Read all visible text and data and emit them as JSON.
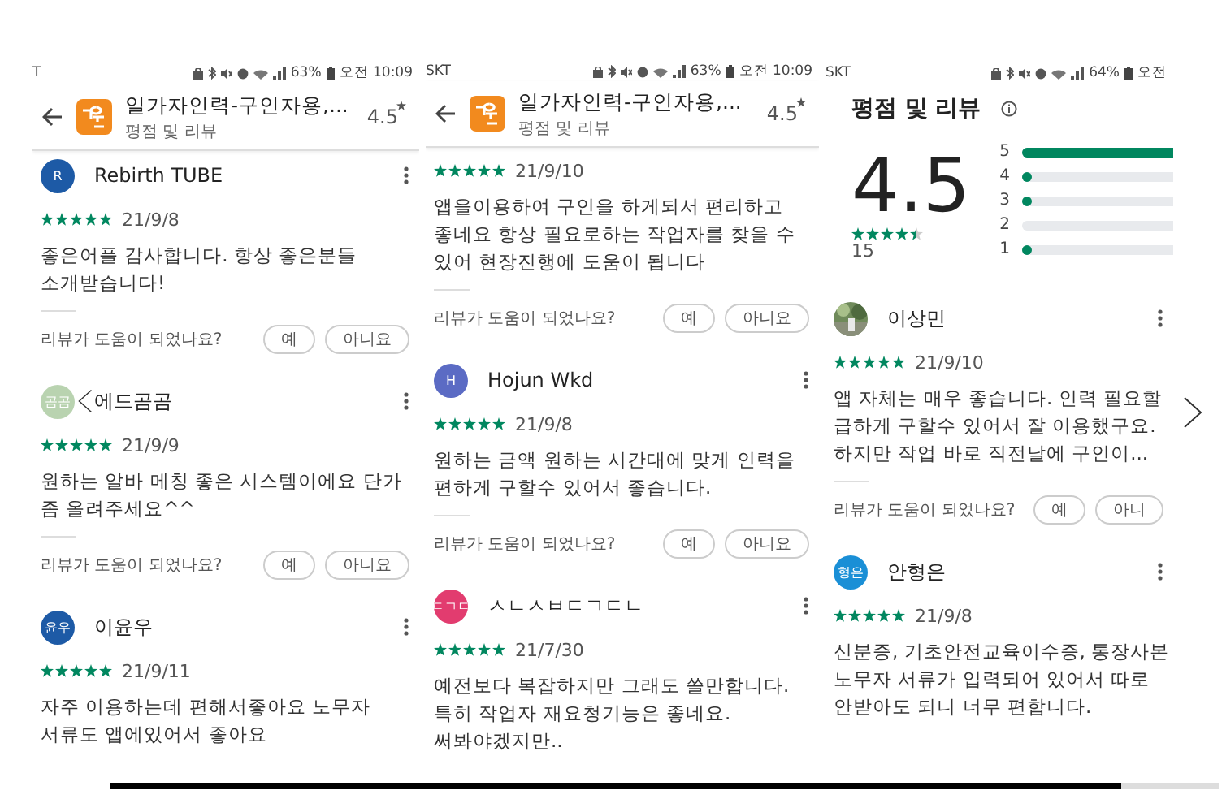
{
  "screens": [
    {
      "status": {
        "carrier": "T",
        "battery": "63%",
        "time": "오전 10:09"
      },
      "header": {
        "title": "일가자인력-구인자용,...",
        "subtitle": "평점 및 리뷰",
        "rating": "4.5"
      },
      "items": [
        {
          "kind": "review",
          "avatar": {
            "text": "R",
            "color": "#1d5aa6"
          },
          "name": "Rebirth TUBE",
          "stars": 5,
          "date": "21/9/8",
          "lines": [
            "좋은어플 감사합니다. 항상 좋은분들",
            "소개받습니다!"
          ],
          "helpful": {
            "prompt": "리뷰가 도움이 되었나요?",
            "yes": "예",
            "no": "아니요"
          }
        },
        {
          "kind": "review",
          "avatar": {
            "text": "곰곰",
            "color": "#b9d3b0"
          },
          "name": "에드곰곰",
          "stars": 5,
          "date": "21/9/9",
          "lines": [
            "원하는 알바 메칭 좋은 시스템이에요 단가",
            "좀 올려주세요^^"
          ],
          "helpful": {
            "prompt": "리뷰가 도움이 되었나요?",
            "yes": "예",
            "no": "아니요"
          }
        },
        {
          "kind": "review",
          "avatar": {
            "text": "윤우",
            "color": "#1d5aa6"
          },
          "name": "이윤우",
          "stars": 5,
          "date": "21/9/11",
          "lines": [
            "자주 이용하는데 편해서좋아요 노무자",
            "서류도 앱에있어서 좋아요"
          ]
        }
      ]
    },
    {
      "status": {
        "carrier": "SKT",
        "battery": "63%",
        "time": "오전 10:09"
      },
      "header": {
        "title": "일가자인력-구인자용,...",
        "subtitle": "평점 및 리뷰",
        "rating": "4.5"
      },
      "items": [
        {
          "kind": "review",
          "stars": 5,
          "date": "21/9/10",
          "lines": [
            "앱을이용하여 구인을 하게되서 편리하고",
            "좋네요 항상 필요로하는 작업자를 찾을 수",
            "있어 현장진행에 도움이 됩니다"
          ],
          "helpful": {
            "prompt": "리뷰가 도움이 되었나요?",
            "yes": "예",
            "no": "아니요"
          }
        },
        {
          "kind": "review",
          "avatar": {
            "text": "H",
            "color": "#5b6bc4"
          },
          "name": "Hojun Wkd",
          "stars": 5,
          "date": "21/9/8",
          "lines": [
            "원하는 금액 원하는 시간대에 맞게 인력을",
            "편하게 구할수 있어서 좋습니다."
          ],
          "helpful": {
            "prompt": "리뷰가 도움이 되었나요?",
            "yes": "예",
            "no": "아니요"
          }
        },
        {
          "kind": "review",
          "avatar": {
            "text": "ㄷㄱㄷ",
            "color": "#e23c6f"
          },
          "name": "ㅅㄴㅅㅂㄷㄱㄷㄴ",
          "stars": 5,
          "date": "21/7/30",
          "lines": [
            "예전보다 복잡하지만 그래도 쓸만합니다.",
            "특히 작업자 재요청기능은 좋네요.",
            "써봐야겠지만.."
          ]
        }
      ]
    },
    {
      "status": {
        "carrier": "SKT",
        "battery": "64%",
        "time": "오전"
      },
      "items": [
        {
          "kind": "summary",
          "title": "평점 및 리뷰",
          "score": "4.5",
          "stars": 4.5,
          "count": "15",
          "bars": [
            {
              "label": "5",
              "level": 0.85
            },
            {
              "label": "4",
              "level": 0.03
            },
            {
              "label": "3",
              "level": 0.03
            },
            {
              "label": "2"
            },
            {
              "label": "1",
              "level": 0.03
            }
          ]
        },
        {
          "kind": "review",
          "name": "이상민",
          "stars": 5,
          "date": "21/9/10",
          "lines": [
            "앱 자체는 매우 좋습니다. 인력 필요할",
            "급하게 구할수 있어서 잘 이용했구요.",
            "하지만 작업 바로 직전날에 구인이..."
          ],
          "helpful": {
            "prompt": "리뷰가 도움이 되었나요?",
            "yes": "예",
            "no": "아니"
          }
        },
        {
          "kind": "review",
          "avatar": {
            "text": "형은",
            "color": "#1a8fd6"
          },
          "name": "안형은",
          "stars": 5,
          "date": "21/9/8",
          "lines": [
            "신분증, 기초안전교육이수증, 통장사본",
            "노무자 서류가 입력되어 있어서 따로",
            "안받아도 되니 너무 편합니다."
          ]
        }
      ]
    }
  ]
}
